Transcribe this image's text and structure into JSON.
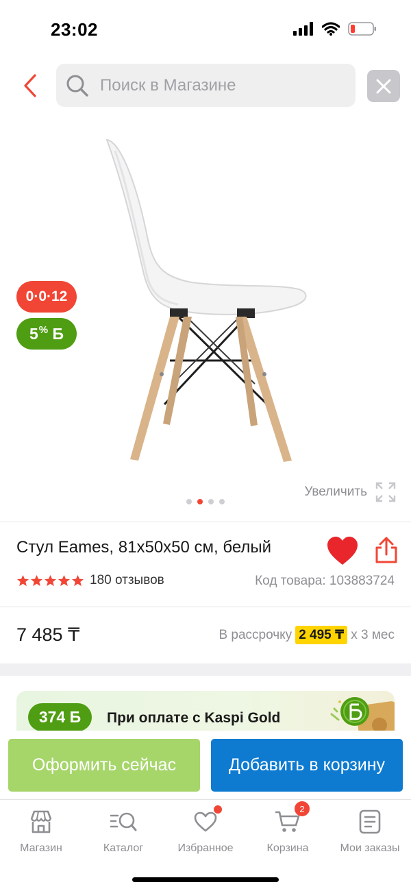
{
  "status_bar": {
    "time": "23:02"
  },
  "search": {
    "placeholder": "Поиск в Магазине"
  },
  "gallery": {
    "badge_installment": "0·0·12",
    "badge_bonus_value": "5",
    "badge_bonus_unit": "%",
    "badge_bonus_symbol": "Б",
    "zoom_label": "Увеличить",
    "slide_count": 4,
    "active_slide": 2
  },
  "product": {
    "title": "Стул Eames, 81x50x50 см, белый",
    "rating": 5,
    "reviews": "180 отзывов",
    "sku_label": "Код товара:",
    "sku_value": "103883724",
    "price": "7 485 ₸",
    "installment_prefix": "В рассрочку",
    "installment_amount": "2 495 ₸",
    "installment_suffix": "x 3 мес"
  },
  "promo": {
    "bonus": "374 Б",
    "text": "При оплате с Kaspi Gold"
  },
  "actions": {
    "buy_now": "Оформить сейчас",
    "add_to_cart": "Добавить в корзину"
  },
  "tabs": [
    {
      "label": "Магазин",
      "icon": "store-icon"
    },
    {
      "label": "Каталог",
      "icon": "catalog-search-icon"
    },
    {
      "label": "Избранное",
      "icon": "heart-outline-icon"
    },
    {
      "label": "Корзина",
      "icon": "cart-icon",
      "badge": "2"
    },
    {
      "label": "Мои заказы",
      "icon": "orders-icon"
    }
  ],
  "colors": {
    "accent_red": "#f14635",
    "bonus_green": "#4f9d12",
    "buy_green": "#a6d56a",
    "cart_blue": "#0e7bd0",
    "installment_yellow": "#ffd400"
  }
}
